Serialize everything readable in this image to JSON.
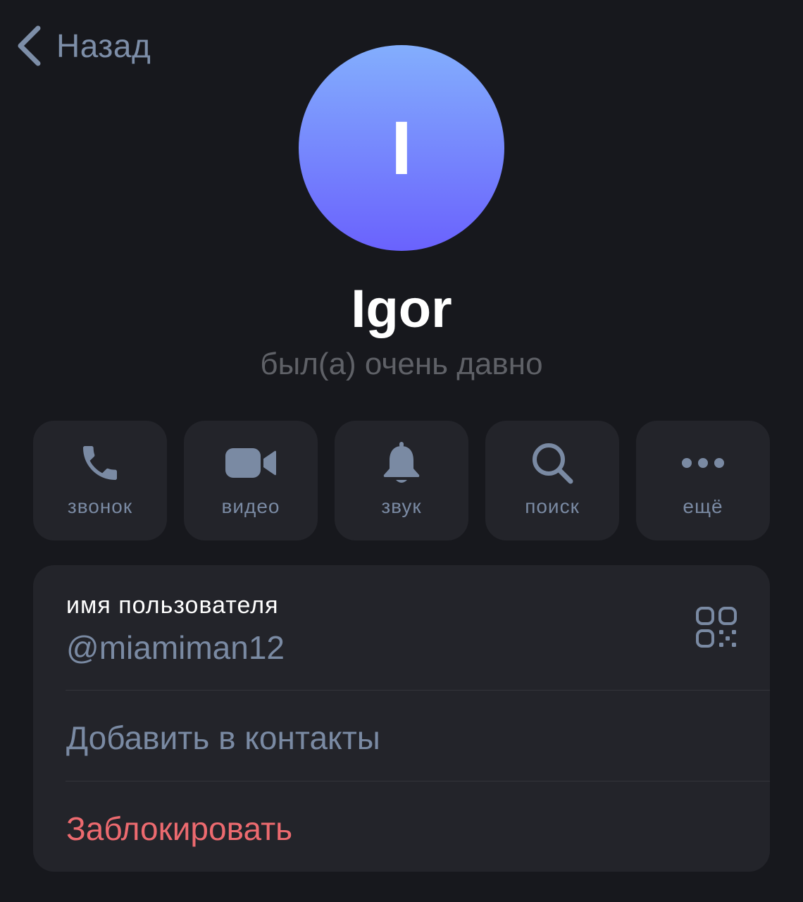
{
  "nav": {
    "back_label": "Назад"
  },
  "profile": {
    "avatar_letter": "I",
    "name": "Igor",
    "status": "был(а) очень давно"
  },
  "actions": [
    {
      "label": "звонок",
      "icon": "phone-icon"
    },
    {
      "label": "видео",
      "icon": "video-camera-icon"
    },
    {
      "label": "звук",
      "icon": "bell-icon"
    },
    {
      "label": "поиск",
      "icon": "search-icon"
    },
    {
      "label": "ещё",
      "icon": "more-dots-icon"
    }
  ],
  "info": {
    "username_caption": "имя пользователя",
    "username_value": "@miamiman12",
    "add_contact_label": "Добавить в контакты",
    "block_label": "Заблокировать"
  },
  "colors": {
    "background": "#17181d",
    "card": "#23242a",
    "accent": "#7a8aa3",
    "danger": "#ec6a6f",
    "avatar_gradient_top": "#83aefd",
    "avatar_gradient_bottom": "#6a62fd"
  }
}
